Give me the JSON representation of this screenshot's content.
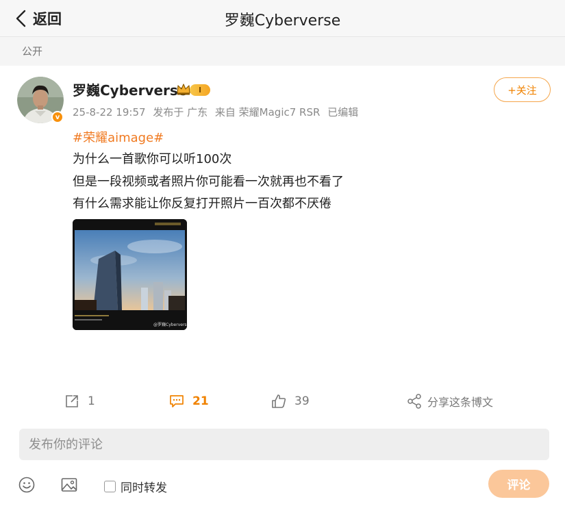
{
  "header": {
    "back_label": "返回",
    "title": "罗巍Cyberverse"
  },
  "visibility": "公开",
  "post": {
    "author": "罗巍Cyberverse",
    "level_badge": "I",
    "meta": {
      "date": "25-8-22 19:57",
      "location": "发布于 广东",
      "source": "来自 荣耀Magic7 RSR",
      "edited": "已编辑"
    },
    "follow_label": "+关注",
    "hashtag": "#荣耀aimage#",
    "lines": [
      "为什么一首歌你可以听100次",
      "但是一段视频或者照片你可能看一次就再也不看了",
      "有什么需求能让你反复打开照片一百次都不厌倦"
    ],
    "photo_watermark": "@罗巍Cyberverse"
  },
  "actions": {
    "repost_count": "1",
    "comment_count": "21",
    "like_count": "39",
    "share_label": "分享这条博文"
  },
  "comment_box": {
    "placeholder": "发布你的评论",
    "repost_label": "同时转发",
    "submit_label": "评论"
  },
  "colors": {
    "accent": "#f08200",
    "hashtag": "#f07a21",
    "submit_disabled": "#fbc79a"
  }
}
